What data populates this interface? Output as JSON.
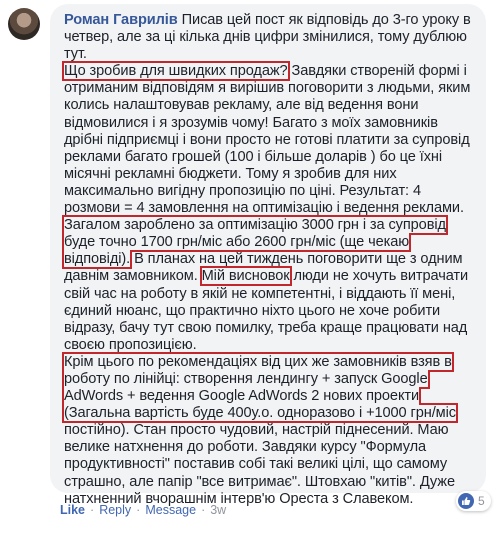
{
  "comment": {
    "author": "Роман Гаврилів",
    "p1": "Писав цей пост як відповідь до 3-го уроку в четвер, але за ці кілька днів цифри змінилися, тому дублюю тут.",
    "q1": "Що зробив для швидких продаж?",
    "p2": " Завдяки створеній формі і отриманим відповідям я вирішив поговорити з людьми, яким колись налаштовував рекламу, але від ведення вони відмовилися і я зрозумів чому! Багато з моїх замовників дрібні підприємці і вони просто не готові платити за супровід реклами багато грошей (100 і більше доларів ) бо це їхні місячні рекламні бюджети. Тому я зробив для них максимально вигідну пропозицію по ціні. Результат: 4 розмови = 4 замовлення на оптимізацію і ведення реклами.",
    "h1": "Загалом зароблено за оптимізацію 3000 грн і за супровід буде точно 1700 грн/міс або 2600 грн/міс (ще чекаю відповіді).",
    "p3": " В планах на цей тиждень поговорити ще з одним давнім замовником.",
    "q2": "Мій висновок",
    "p4": " люди не хочуть витрачати свій час на роботу в якій не компетентні, і віддають її мені, єдиний нюанс, що практично ніхто цього не хоче робити відразу, бачу тут свою помилку, треба краще працювати над своєю пропозицією.",
    "h2": "Крім цього по рекомендаціях від цих же замовників взяв в роботу по лінійці: створення лендингу + запуск Google AdWords + ведення Google AdWords 2 нових проекти (Загальна вартість буде 400у.о. одноразово і +1000 грн/міс",
    "p5": " постійно). Стан просто чудовий, настрій піднесений. Маю велике натхнення до роботи. Завдяки курсу \"Формула продуктивності\" поставив собі такі великі цілі, що самому страшно, але папір \"все витримає\". Штовхаю \"китів\". Дуже натхненний вчорашнім інтерв'ю Ореста з Славеком."
  },
  "reactions": {
    "icon": "thumbs-up-icon",
    "count": "5",
    "color": "#4267b2"
  },
  "actions": {
    "like": "Like",
    "reply": "Reply",
    "message": "Message",
    "time": "3w",
    "sep": "·"
  },
  "highlight_color": "#c0282d"
}
